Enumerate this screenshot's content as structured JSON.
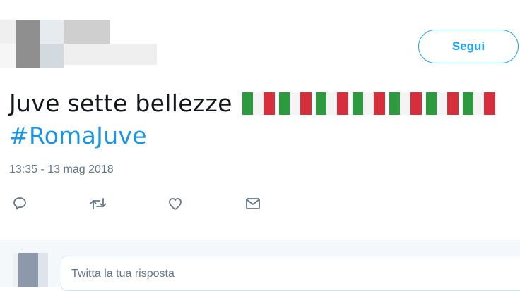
{
  "follow_button": {
    "label": "Segui"
  },
  "tweet": {
    "text": "Juve sette bellezze",
    "flag_count": 7,
    "hashtag": "#RomaJuve",
    "timestamp": "13:35 - 13 mag 2018"
  },
  "actions": {
    "reply": "reply-icon",
    "retweet": "retweet-icon",
    "like": "heart-icon",
    "message": "mail-icon"
  },
  "reply_box": {
    "placeholder": "Twitta la tua risposta"
  },
  "colors": {
    "accent": "#1da1f2",
    "hashtag": "#1b95e0",
    "muted": "#657786",
    "flag_green": "#2d9a3f",
    "flag_white": "#f4f4f4",
    "flag_red": "#d62e3a"
  }
}
